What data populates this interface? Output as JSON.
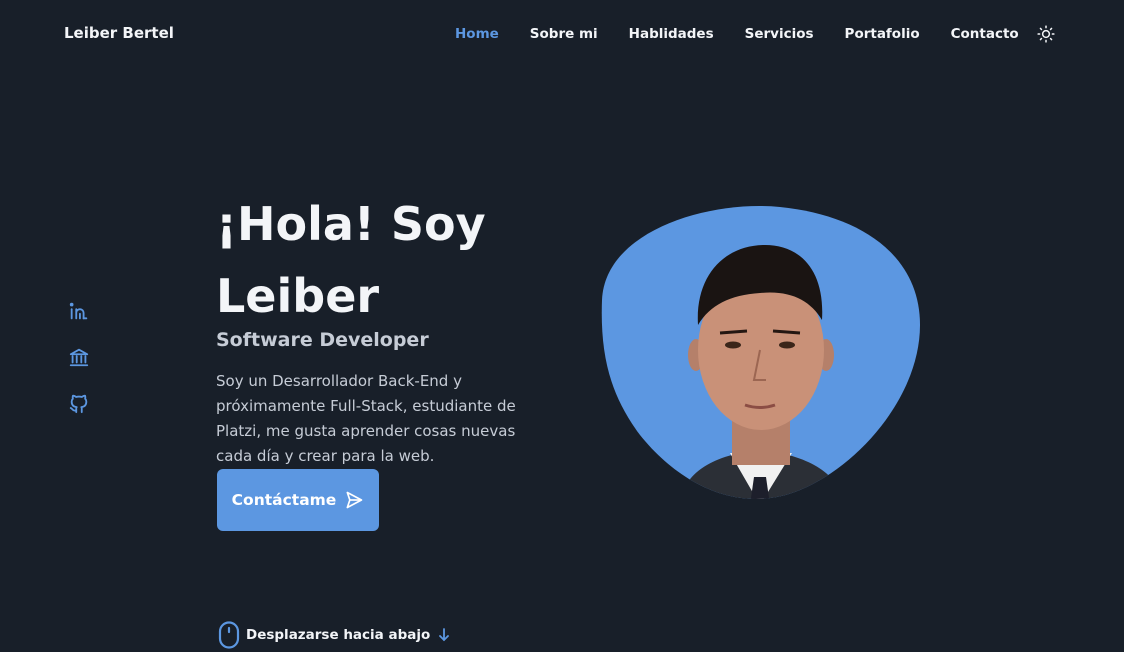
{
  "header": {
    "brand": "Leiber Bertel",
    "nav": [
      {
        "label": "Home",
        "active": true
      },
      {
        "label": "Sobre mi",
        "active": false
      },
      {
        "label": "Hablidades",
        "active": false
      },
      {
        "label": "Servicios",
        "active": false
      },
      {
        "label": "Portafolio",
        "active": false
      },
      {
        "label": "Contacto",
        "active": false
      }
    ],
    "theme_icon": "sun-icon"
  },
  "social": [
    {
      "icon": "linkedin-icon"
    },
    {
      "icon": "bank-icon"
    },
    {
      "icon": "github-icon"
    }
  ],
  "hero": {
    "title": "¡Hola! Soy Leiber",
    "subtitle": "Software Developer",
    "description": "Soy un Desarrollador Back-End y próximamente Full-Stack, estudiante de Platzi, me gusta aprender cosas nuevas cada día y crear para la web.",
    "cta_label": "Contáctame",
    "cta_icon": "send-icon"
  },
  "scroll": {
    "label": "Desplazarse hacia abajo",
    "icon": "mouse-icon",
    "arrow_icon": "arrow-down-icon"
  },
  "colors": {
    "background": "#181f29",
    "accent": "#5c97e1",
    "text": "#f3f5f8",
    "muted": "#c6ccd6"
  }
}
